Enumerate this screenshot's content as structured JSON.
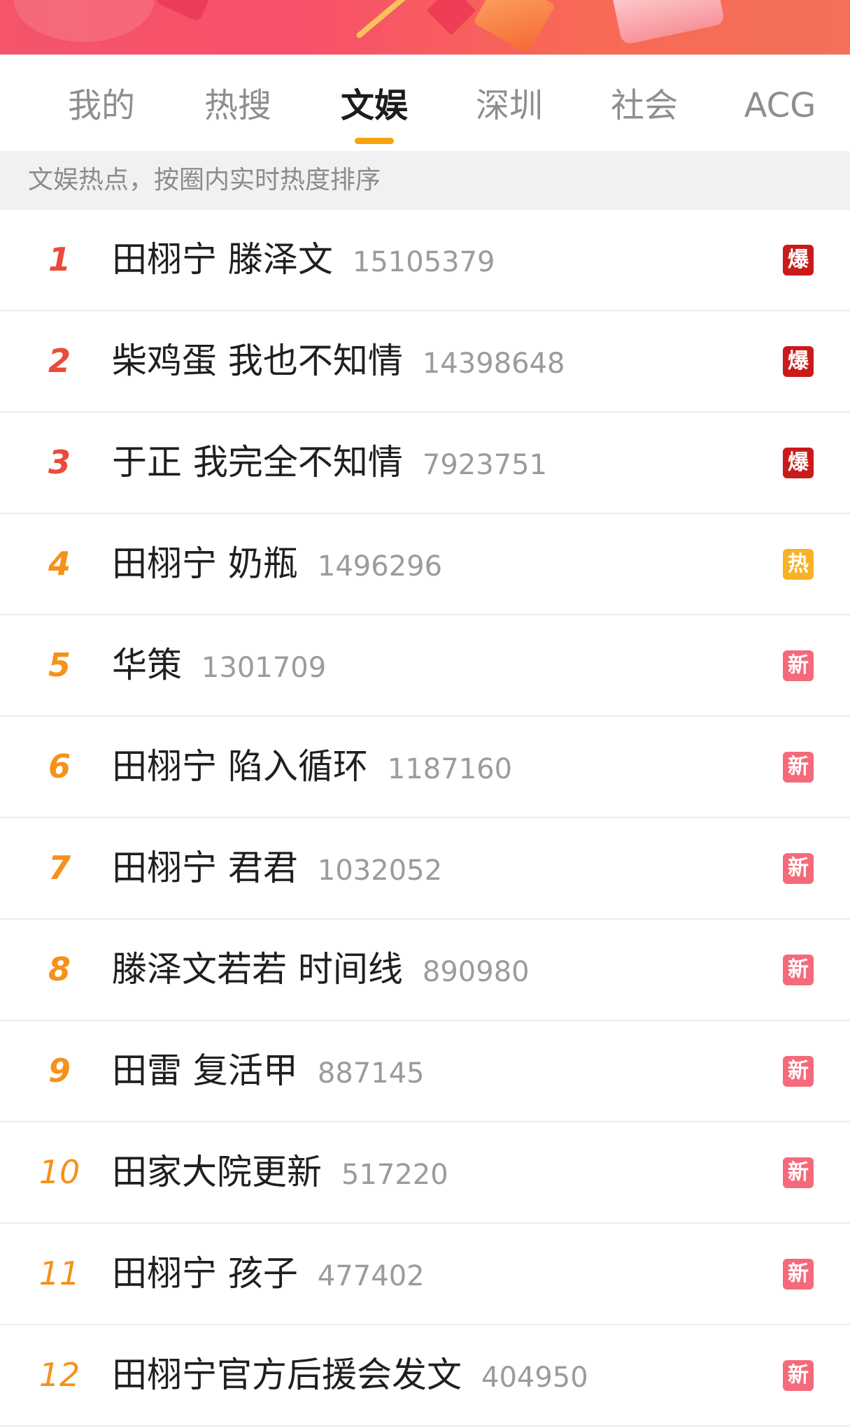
{
  "tabs": [
    {
      "label": "我的"
    },
    {
      "label": "热搜"
    },
    {
      "label": "文娱"
    },
    {
      "label": "深圳"
    },
    {
      "label": "社会"
    },
    {
      "label": "ACG"
    }
  ],
  "active_tab": "文娱",
  "subhead": "文娱热点，按圈内实时热度排序",
  "colors": {
    "badge_bao": "#c91b1b",
    "badge_re": "#f7b225",
    "badge_xin": "#f56a7a",
    "rank_top": "#ea4b3b",
    "rank_other": "#f4921c",
    "tab_underline": "#f7a20f"
  },
  "items": [
    {
      "rank": "1",
      "title": "田栩宁 滕泽文",
      "count": "15105379",
      "badge": "爆"
    },
    {
      "rank": "2",
      "title": "柴鸡蛋 我也不知情",
      "count": "14398648",
      "badge": "爆"
    },
    {
      "rank": "3",
      "title": "于正 我完全不知情",
      "count": "7923751",
      "badge": "爆"
    },
    {
      "rank": "4",
      "title": "田栩宁 奶瓶",
      "count": "1496296",
      "badge": "热"
    },
    {
      "rank": "5",
      "title": "华策",
      "count": "1301709",
      "badge": "新"
    },
    {
      "rank": "6",
      "title": "田栩宁 陷入循环",
      "count": "1187160",
      "badge": "新"
    },
    {
      "rank": "7",
      "title": "田栩宁 君君",
      "count": "1032052",
      "badge": "新"
    },
    {
      "rank": "8",
      "title": "滕泽文若若 时间线",
      "count": "890980",
      "badge": "新"
    },
    {
      "rank": "9",
      "title": "田雷 复活甲",
      "count": "887145",
      "badge": "新"
    },
    {
      "rank": "10",
      "title": "田家大院更新",
      "count": "517220",
      "badge": "新"
    },
    {
      "rank": "11",
      "title": "田栩宁 孩子",
      "count": "477402",
      "badge": "新"
    },
    {
      "rank": "12",
      "title": "田栩宁官方后援会发文",
      "count": "404950",
      "badge": "新"
    }
  ]
}
